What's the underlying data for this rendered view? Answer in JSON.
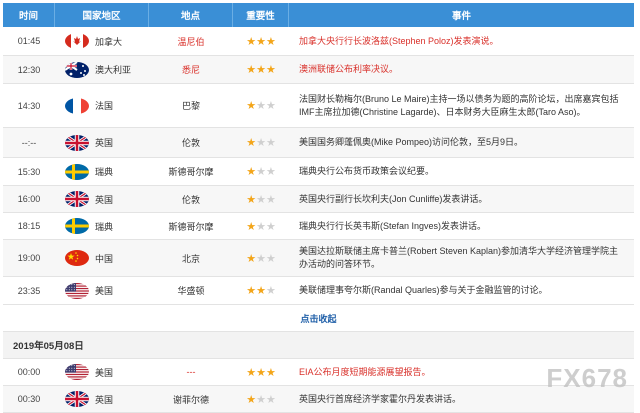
{
  "headers": {
    "time": "时间",
    "country": "国家地区",
    "place": "地点",
    "importance": "重要性",
    "event": "事件"
  },
  "rows": [
    {
      "time": "01:45",
      "country": "加拿大",
      "flag": "ca",
      "place": "温尼伯",
      "place_red": true,
      "stars": 3,
      "event": "加拿大央行行长波洛兹(Stephen Poloz)发表演说。",
      "event_red": true,
      "h": 29
    },
    {
      "time": "12:30",
      "country": "澳大利亚",
      "flag": "au",
      "place": "悉尼",
      "place_red": true,
      "stars": 3,
      "event": "澳洲联储公布利率决议。",
      "event_red": true,
      "h": 28
    },
    {
      "time": "14:30",
      "country": "法国",
      "flag": "fr",
      "place": "巴黎",
      "place_red": false,
      "stars": 1,
      "event": "法国财长勒梅尔(Bruno Le Maire)主持一场以债务为题的高阶论坛，出席嘉宾包括IMF主席拉加德(Christine Lagarde)、日本财务大臣麻生太郎(Taro Aso)。",
      "event_red": false,
      "h": 44
    },
    {
      "time": "--:--",
      "country": "英国",
      "flag": "uk",
      "place": "伦敦",
      "place_red": false,
      "stars": 1,
      "event": "美国国务卿蓬佩奥(Mike Pompeo)访问伦敦，至5月9日。",
      "event_red": false,
      "h": 30
    },
    {
      "time": "15:30",
      "country": "瑞典",
      "flag": "se",
      "place": "斯德哥尔摩",
      "place_red": false,
      "stars": 1,
      "event": "瑞典央行公布货币政策会议纪要。",
      "event_red": false,
      "h": 28
    },
    {
      "time": "16:00",
      "country": "英国",
      "flag": "uk",
      "place": "伦敦",
      "place_red": false,
      "stars": 1,
      "event": "英国央行副行长坎利夫(Jon Cunliffe)发表讲话。",
      "event_red": false,
      "h": 27
    },
    {
      "time": "18:15",
      "country": "瑞典",
      "flag": "se",
      "place": "斯德哥尔摩",
      "place_red": false,
      "stars": 1,
      "event": "瑞典央行行长英韦斯(Stefan Ingves)发表讲话。",
      "event_red": false,
      "h": 27
    },
    {
      "time": "19:00",
      "country": "中国",
      "flag": "cn",
      "place": "北京",
      "place_red": false,
      "stars": 1,
      "event": "美国达拉斯联储主席卡普兰(Robert Steven Kaplan)参加清华大学经济管理学院主办活动的问答环节。",
      "event_red": false,
      "h": 37
    },
    {
      "time": "23:35",
      "country": "美国",
      "flag": "us",
      "place": "华盛顿",
      "place_red": false,
      "stars": 2,
      "event": "美联储理事夸尔斯(Randal Quarles)参与关于金融监管的讨论。",
      "event_red": false,
      "h": 28
    }
  ],
  "more_label": "点击收起",
  "date_label": "2019年05月08日",
  "rows2": [
    {
      "time": "00:00",
      "country": "美国",
      "flag": "us",
      "place": "---",
      "place_red": true,
      "stars": 3,
      "event": "EIA公布月度短期能源展望报告。",
      "event_red": true,
      "h": 27
    },
    {
      "time": "00:30",
      "country": "英国",
      "flag": "uk",
      "place": "谢菲尔德",
      "place_red": false,
      "stars": 1,
      "event": "英国央行首席经济学家霍尔丹发表讲话。",
      "event_red": false,
      "h": 27
    }
  ],
  "watermark": "FX678"
}
